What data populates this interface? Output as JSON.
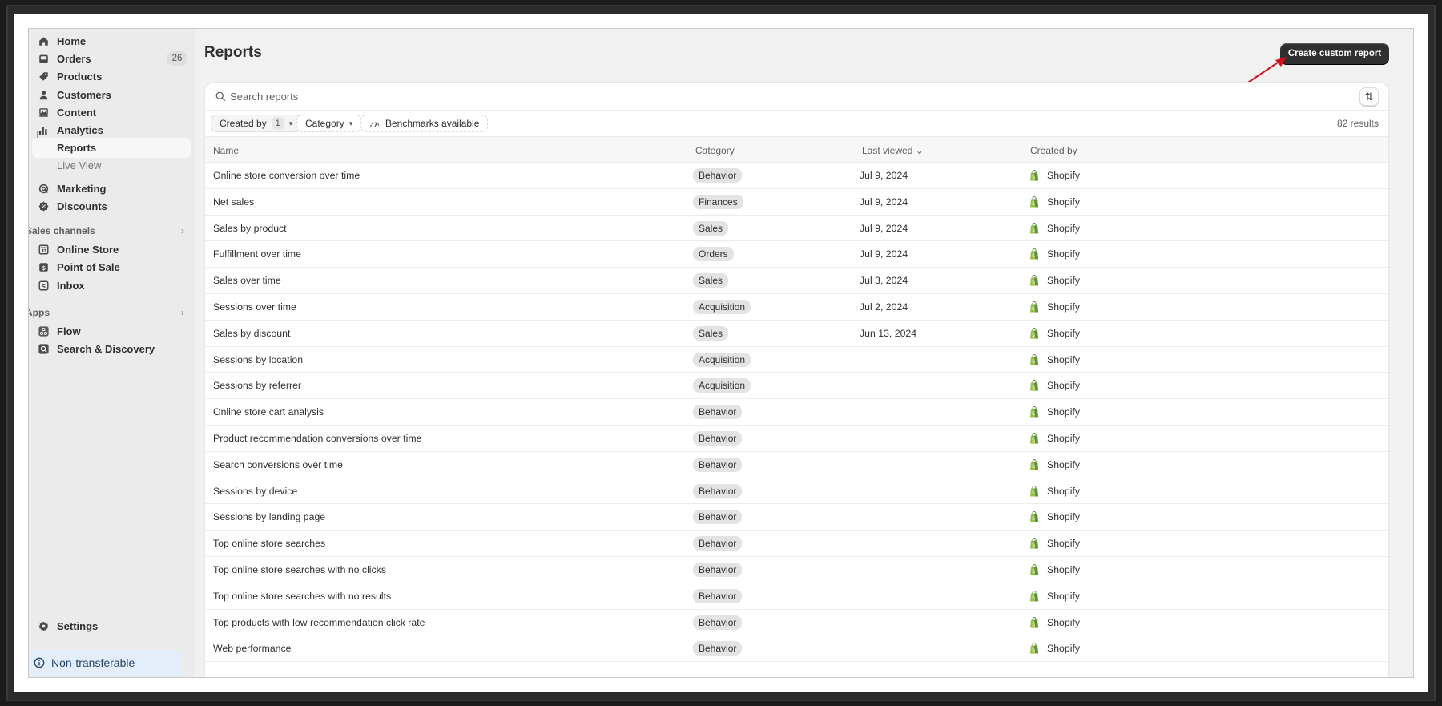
{
  "sidebar": {
    "items": [
      {
        "label": "Home",
        "icon": "home-icon"
      },
      {
        "label": "Orders",
        "icon": "inbox-icon",
        "badge": "26"
      },
      {
        "label": "Products",
        "icon": "tag-icon"
      },
      {
        "label": "Customers",
        "icon": "person-icon"
      },
      {
        "label": "Content",
        "icon": "image-icon"
      },
      {
        "label": "Analytics",
        "icon": "bar-chart-icon"
      },
      {
        "label": "Reports",
        "icon": "",
        "active": true
      },
      {
        "label": "Live View",
        "icon": ""
      },
      {
        "label": "Marketing",
        "icon": "target-icon"
      },
      {
        "label": "Discounts",
        "icon": "discount-icon"
      }
    ],
    "sales_channels": {
      "heading": "Sales channels",
      "items": [
        {
          "label": "Online Store",
          "icon": "store-icon"
        },
        {
          "label": "Point of Sale",
          "icon": "pos-icon"
        },
        {
          "label": "Inbox",
          "icon": "chat-icon"
        }
      ]
    },
    "apps": {
      "heading": "Apps",
      "items": [
        {
          "label": "Flow",
          "icon": "flow-icon"
        },
        {
          "label": "Search & Discovery",
          "icon": "search-discovery-icon"
        }
      ]
    },
    "settings_label": "Settings",
    "notice_label": "Non-transferable"
  },
  "header": {
    "title": "Reports",
    "create_button": "Create custom report"
  },
  "search": {
    "placeholder": "Search reports",
    "value": ""
  },
  "filters": {
    "created_by": {
      "label": "Created by",
      "count": "1"
    },
    "category": {
      "label": "Category"
    },
    "benchmarks": {
      "label": "Benchmarks available"
    },
    "results": "82 results"
  },
  "table": {
    "columns": [
      "Name",
      "Category",
      "Last viewed",
      "Created by"
    ],
    "sort_indicator": "⌄",
    "rows": [
      {
        "name": "Online store conversion over time",
        "category": "Behavior",
        "last_viewed": "Jul 9, 2024",
        "created_by": "Shopify"
      },
      {
        "name": "Net sales",
        "category": "Finances",
        "last_viewed": "Jul 9, 2024",
        "created_by": "Shopify"
      },
      {
        "name": "Sales by product",
        "category": "Sales",
        "last_viewed": "Jul 9, 2024",
        "created_by": "Shopify"
      },
      {
        "name": "Fulfillment over time",
        "category": "Orders",
        "last_viewed": "Jul 9, 2024",
        "created_by": "Shopify"
      },
      {
        "name": "Sales over time",
        "category": "Sales",
        "last_viewed": "Jul 3, 2024",
        "created_by": "Shopify"
      },
      {
        "name": "Sessions over time",
        "category": "Acquisition",
        "last_viewed": "Jul 2, 2024",
        "created_by": "Shopify"
      },
      {
        "name": "Sales by discount",
        "category": "Sales",
        "last_viewed": "Jun 13, 2024",
        "created_by": "Shopify"
      },
      {
        "name": "Sessions by location",
        "category": "Acquisition",
        "last_viewed": "",
        "created_by": "Shopify"
      },
      {
        "name": "Sessions by referrer",
        "category": "Acquisition",
        "last_viewed": "",
        "created_by": "Shopify"
      },
      {
        "name": "Online store cart analysis",
        "category": "Behavior",
        "last_viewed": "",
        "created_by": "Shopify"
      },
      {
        "name": "Product recommendation conversions over time",
        "category": "Behavior",
        "last_viewed": "",
        "created_by": "Shopify"
      },
      {
        "name": "Search conversions over time",
        "category": "Behavior",
        "last_viewed": "",
        "created_by": "Shopify"
      },
      {
        "name": "Sessions by device",
        "category": "Behavior",
        "last_viewed": "",
        "created_by": "Shopify"
      },
      {
        "name": "Sessions by landing page",
        "category": "Behavior",
        "last_viewed": "",
        "created_by": "Shopify"
      },
      {
        "name": "Top online store searches",
        "category": "Behavior",
        "last_viewed": "",
        "created_by": "Shopify"
      },
      {
        "name": "Top online store searches with no clicks",
        "category": "Behavior",
        "last_viewed": "",
        "created_by": "Shopify"
      },
      {
        "name": "Top online store searches with no results",
        "category": "Behavior",
        "last_viewed": "",
        "created_by": "Shopify"
      },
      {
        "name": "Top products with low recommendation click rate",
        "category": "Behavior",
        "last_viewed": "",
        "created_by": "Shopify"
      },
      {
        "name": "Web performance",
        "category": "Behavior",
        "last_viewed": "",
        "created_by": "Shopify"
      }
    ]
  },
  "colors": {
    "annotation_arrow": "#d0121b",
    "primary_button": "#303030",
    "shopify_green": "#95bf47",
    "notice_bg": "#e4eefb"
  }
}
